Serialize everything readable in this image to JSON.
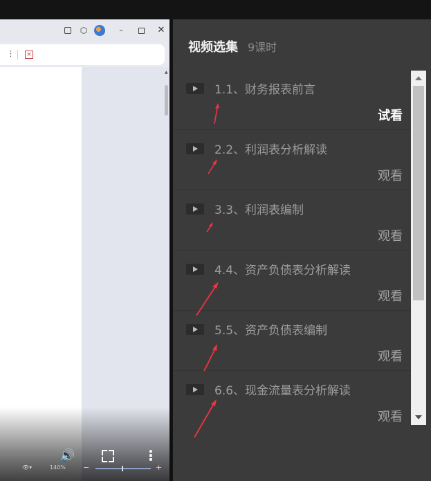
{
  "panel": {
    "title": "视频选集",
    "count": "9课时"
  },
  "lessons": [
    {
      "title": "1.1、财务报表前言",
      "action": "试看"
    },
    {
      "title": "2.2、利润表分析解读",
      "action": "观看"
    },
    {
      "title": "3.3、利润表编制",
      "action": "观看"
    },
    {
      "title": "4.4、资产负债表分析解读",
      "action": "观看"
    },
    {
      "title": "5.5、资产负债表编制",
      "action": "观看"
    },
    {
      "title": "6.6、现金流量表分析解读",
      "action": "观看"
    }
  ],
  "viewer": {
    "menu_glyph": "⋮",
    "zoom": "140%",
    "minus": "−",
    "plus": "+",
    "eye": "👁▾",
    "zoom_level": 0.47
  },
  "icons": {
    "play": "play-icon",
    "volume": "volume-icon",
    "fullscreen": "fullscreen-icon",
    "more": "more-vertical-icon",
    "annotation_arrow": "red-arrow"
  },
  "colors": {
    "panel_bg": "#3b3b3b",
    "arrow": "#ee3344",
    "trial_text": "#ffffff",
    "watch_text": "#a3a3a3"
  }
}
